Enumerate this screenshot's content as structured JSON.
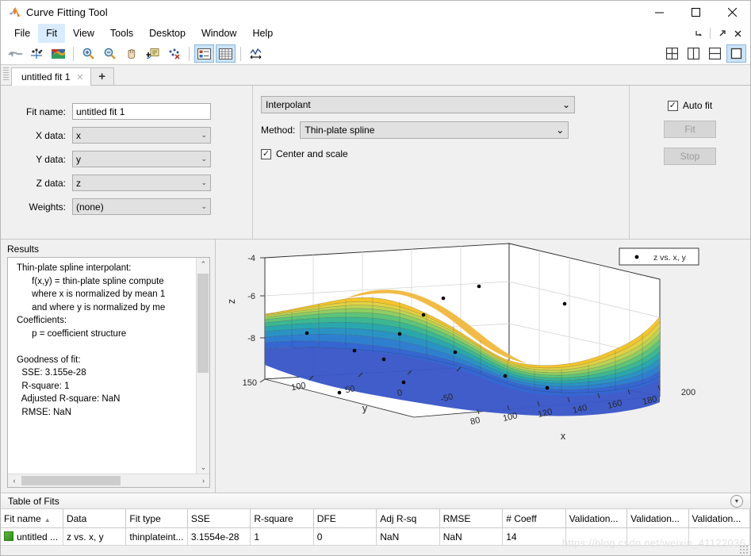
{
  "window": {
    "title": "Curve Fitting Tool",
    "app_icon": "matlab-icon",
    "minimize": "—",
    "maximize": "☐",
    "close": "✕"
  },
  "menubar": {
    "items": [
      {
        "label": "File",
        "active": false
      },
      {
        "label": "Fit",
        "active": true
      },
      {
        "label": "View",
        "active": false
      },
      {
        "label": "Tools",
        "active": false
      },
      {
        "label": "Desktop",
        "active": false
      },
      {
        "label": "Window",
        "active": false
      },
      {
        "label": "Help",
        "active": false
      }
    ],
    "right_icons": [
      "undock-icon",
      "popout-icon",
      "close-icon"
    ]
  },
  "toolbar": {
    "buttons": [
      "fit-curve-icon",
      "data-points-icon",
      "surface-plot-icon",
      "zoom-in-icon",
      "zoom-out-icon",
      "pan-icon",
      "data-cursor-icon",
      "exclude-outliers-icon",
      "show-legend-icon",
      "show-grid-icon",
      "axes-limits-icon"
    ],
    "layout_buttons": [
      "layout-quad-icon",
      "layout-vertical-icon",
      "layout-horizontal-icon",
      "layout-single-icon"
    ]
  },
  "tabs": {
    "items": [
      {
        "label": "untitled fit 1",
        "close": "✕"
      }
    ],
    "add_label": "+"
  },
  "fit_options": {
    "fit_name_label": "Fit name:",
    "fit_name_value": "untitled fit 1",
    "x_data_label": "X data:",
    "x_data_value": "x",
    "y_data_label": "Y data:",
    "y_data_value": "y",
    "z_data_label": "Z data:",
    "z_data_value": "z",
    "weights_label": "Weights:",
    "weights_value": "(none)",
    "fit_type_value": "Interpolant",
    "method_label": "Method:",
    "method_value": "Thin-plate spline",
    "center_and_scale_label": "Center and scale",
    "center_and_scale_checked": true,
    "auto_fit_label": "Auto fit",
    "auto_fit_checked": true,
    "fit_button_label": "Fit",
    "stop_button_label": "Stop",
    "chevron": "⌄",
    "check_glyph": "✓"
  },
  "results": {
    "title": "Results",
    "text": "Thin-plate spline interpolant:\n      f(x,y) = thin-plate spline compute\n      where x is normalized by mean 1\n      and where y is normalized by me\nCoefficients:\n      p = coefficient structure\n\nGoodness of fit:\n  SSE: 3.155e-28\n  R-square: 1\n  Adjusted R-square: NaN\n  RMSE: NaN",
    "scroll_up": "⌃",
    "scroll_down": "⌄",
    "scroll_left": "‹",
    "scroll_right": "›"
  },
  "table_of_fits": {
    "title": "Table of Fits",
    "collapse_icon": "▼",
    "columns": [
      "Fit name",
      "Data",
      "Fit type",
      "SSE",
      "R-square",
      "DFE",
      "Adj R-sq",
      "RMSE",
      "# Coeff",
      "Validation...",
      "Validation...",
      "Validation..."
    ],
    "sorted_column": 0,
    "sort_caret": "▲",
    "rows": [
      {
        "cells": [
          "untitled ...",
          "z vs. x, y",
          "thinplateint...",
          "3.1554e-28",
          "1",
          "0",
          "NaN",
          "NaN",
          "14",
          "",
          "",
          ""
        ]
      }
    ]
  },
  "plot": {
    "legend_label": "z vs. x, y",
    "x_axis_label": "x",
    "y_axis_label": "y",
    "z_axis_label": "z",
    "background": "#f0f0f0",
    "surface_colors": [
      "#3b4cc0",
      "#3f66d4",
      "#2f9bbd",
      "#2fb89b",
      "#62c76b",
      "#a6d34a",
      "#e2d13a",
      "#f9c222",
      "#f0a93a"
    ]
  },
  "chart_data": {
    "type": "surface",
    "title": "",
    "xlabel": "x",
    "ylabel": "y",
    "zlabel": "z",
    "legend": [
      "z vs. x, y"
    ],
    "x_ticks": [
      80,
      100,
      120,
      140,
      160,
      180,
      200
    ],
    "y_ticks": [
      150,
      100,
      50,
      0,
      -50
    ],
    "z_ticks": [
      -4,
      -6,
      -8
    ],
    "xlim": [
      70,
      205
    ],
    "ylim": [
      -70,
      160
    ],
    "zlim": [
      -9.2,
      -3.4
    ],
    "grid": true,
    "colormap": "parula",
    "scatter_points": [
      {
        "x": 104,
        "y": 120,
        "z": -8.05
      },
      {
        "x": 112,
        "y": 48,
        "z": -8.35
      },
      {
        "x": 120,
        "y": 5,
        "z": -8.55
      },
      {
        "x": 126,
        "y": -22,
        "z": -8.6
      },
      {
        "x": 134,
        "y": 72,
        "z": -6.9
      },
      {
        "x": 140,
        "y": 30,
        "z": -6.0
      },
      {
        "x": 150,
        "y": 12,
        "z": -5.6
      },
      {
        "x": 158,
        "y": -20,
        "z": -6.4
      },
      {
        "x": 166,
        "y": -46,
        "z": -8.5
      },
      {
        "x": 96,
        "y": -52,
        "z": -8.8
      },
      {
        "x": 88,
        "y": -62,
        "z": -8.9
      },
      {
        "x": 176,
        "y": -48,
        "z": -8.6
      },
      {
        "x": 146,
        "y": 96,
        "z": -4.6
      },
      {
        "x": 130,
        "y": 110,
        "z": -4.5
      }
    ]
  },
  "watermark": "https://blog.csdn.net/weixin_41122036"
}
